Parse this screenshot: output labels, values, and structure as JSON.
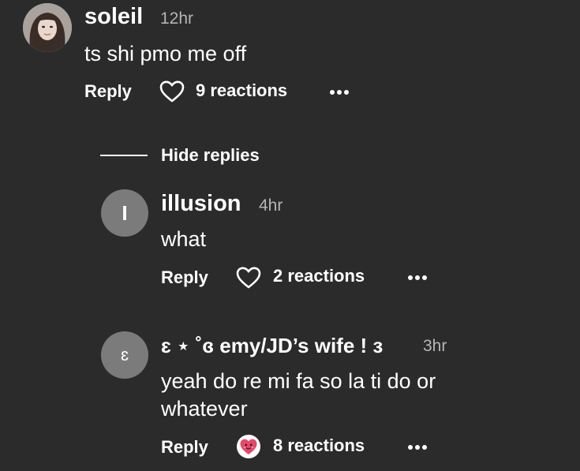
{
  "comment": {
    "username": "soleil",
    "time": "12hr",
    "text": "ts shi pmo me off",
    "reply_label": "Reply",
    "reactions": "9 reactions"
  },
  "hide_replies_label": "Hide replies",
  "replies": [
    {
      "avatar_letter": "I",
      "username": "illusion",
      "time": "4hr",
      "text": "what",
      "reply_label": "Reply",
      "reactions": "2 reactions"
    },
    {
      "avatar_letter": "ɛ",
      "username": "ɛ ⋆ ˚ɞ emy/JD’s wife ! ɜ",
      "time": "3hr",
      "text_line1": "yeah do re mi fa so la ti do or",
      "text_line2": "whatever",
      "reply_label": "Reply",
      "reactions": "8 reactions"
    }
  ],
  "colors": {
    "background": "#2b2b2b",
    "avatar_gray": "#7b7b7b",
    "timestamp_gray": "#b5b5b5",
    "reaction_emoji_pink": "#e5486b"
  },
  "icons": {
    "heart": "heart-outline-icon",
    "more": "ellipsis-icon",
    "reaction": "heart-face-emoji-icon"
  }
}
